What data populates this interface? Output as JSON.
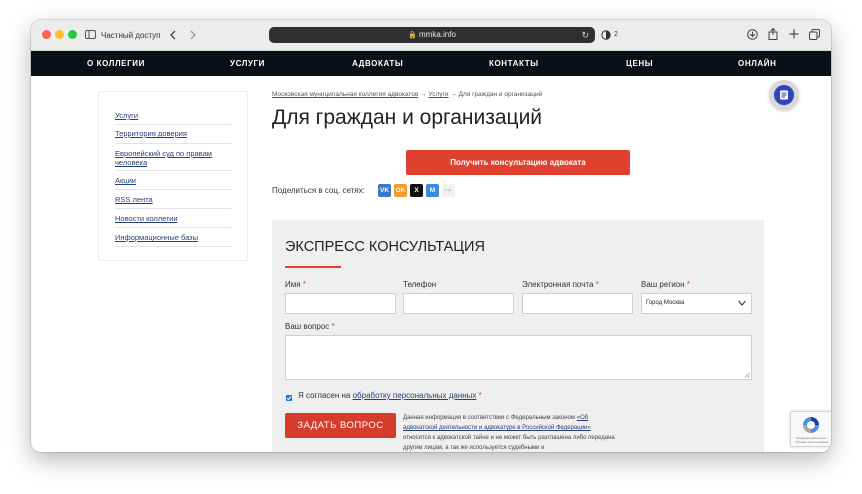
{
  "browser": {
    "private_label": "Частный доступ",
    "url": "mmka.info",
    "shield_count": "2"
  },
  "nav": {
    "items": [
      {
        "label": "О КОЛЛЕГИИ"
      },
      {
        "label": "УСЛУГИ"
      },
      {
        "label": "АДВОКАТЫ"
      },
      {
        "label": "КОНТАКТЫ"
      },
      {
        "label": "ЦЕНЫ"
      },
      {
        "label": "ОНЛАЙН"
      }
    ]
  },
  "sidebar": {
    "items": [
      {
        "label": "Услуги"
      },
      {
        "label": "Территория доверия"
      },
      {
        "label": "Европейский суд по правам человека"
      },
      {
        "label": "Акции"
      },
      {
        "label": "RSS лента"
      },
      {
        "label": "Новости коллегии"
      },
      {
        "label": "Информационные базы"
      }
    ]
  },
  "breadcrumb": {
    "home": "Московская муниципальная коллегия адвокатов",
    "sep": "→",
    "services": "Услуги",
    "current": "Для граждан и организаций"
  },
  "page": {
    "title": "Для граждан и организаций",
    "cta_label": "Получить консультацию адвоката",
    "share_label": "Поделиться в соц. сетях:"
  },
  "share": {
    "buttons": [
      {
        "label": "VK",
        "color": "#3a78c2"
      },
      {
        "label": "OK",
        "color": "#f59a2b"
      },
      {
        "label": "X",
        "color": "#111111"
      },
      {
        "label": "M",
        "color": "#3b8be0"
      },
      {
        "label": "···",
        "color": "#f1f1f1"
      }
    ]
  },
  "form": {
    "title": "ЭКСПРЕСС КОНСУЛЬТАЦИЯ",
    "name_label": "Имя",
    "phone_label": "Телефон",
    "email_label": "Электронная почта",
    "region_label": "Ваш регион",
    "region_value": "Город Москва",
    "question_label": "Ваш вопрос",
    "required_mark": "*",
    "consent_prefix": "Я согласен на",
    "consent_link": "обработку персональных данных",
    "submit_label": "ЗАДАТЬ ВОПРОС",
    "legal_1": "Данная информация в соответствии с Федеральным законом",
    "legal_link": "«Об адвокатской деятельности и адвокатуре в Российской Федерации»",
    "legal_2": "относится к адвокатской тайне и не может быть разглашена либо передана другим лицам, а так же используется судебными и"
  },
  "recaptcha": {
    "text": "Конфиденциальность - Условия использования"
  },
  "colors": {
    "accent": "#e0412f",
    "nav_bg": "#0b0f17",
    "link": "#28407a",
    "fab": "#2f47b6"
  }
}
